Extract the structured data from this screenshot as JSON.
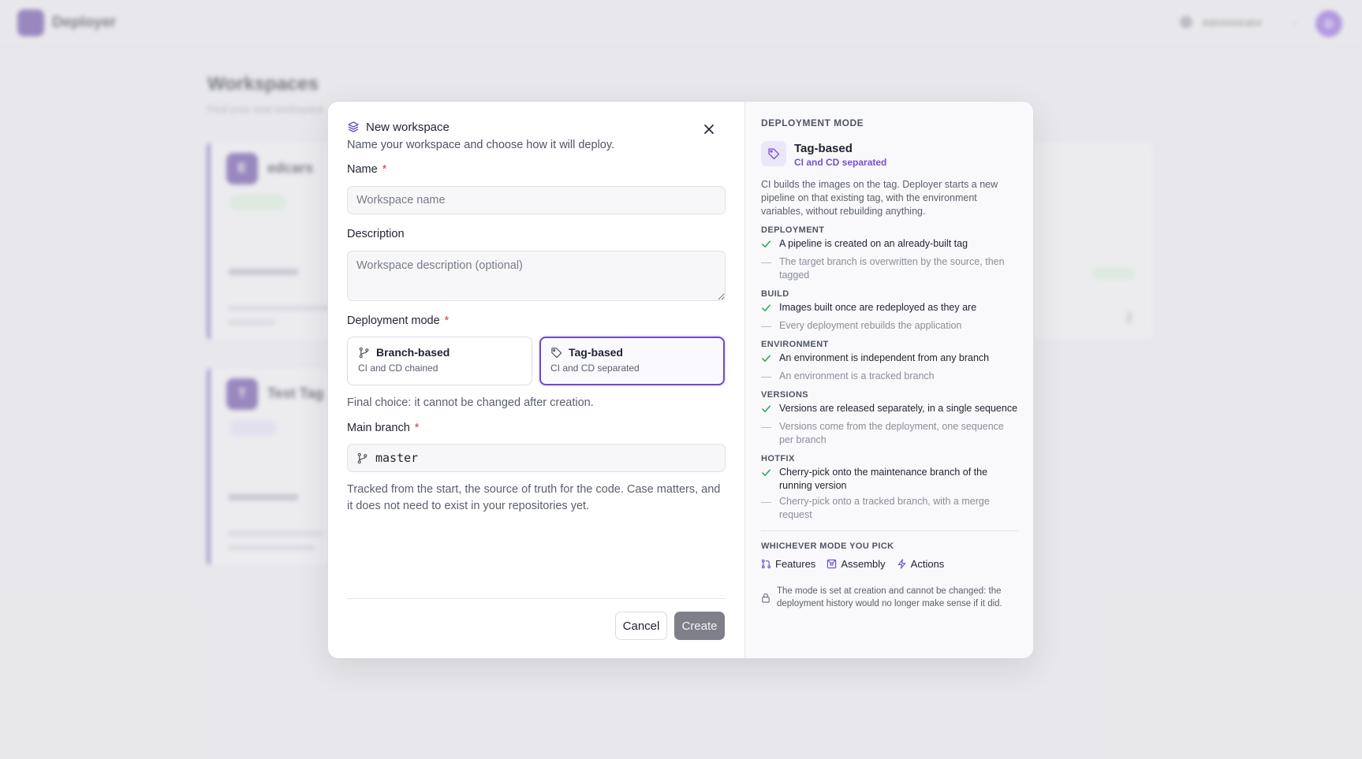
{
  "background": {
    "app_name": "Deployer",
    "user_name": "Administrator",
    "avatar_initial": "D",
    "page_title": "Workspaces",
    "page_subtitle": "Find your new workspace",
    "cards": [
      {
        "initial": "E",
        "name": "edcars",
        "owner": "Administrator"
      },
      {
        "initial": "T",
        "name": "Test Tag",
        "owner": "Administrator"
      }
    ]
  },
  "modal": {
    "title": "New workspace",
    "subtitle": "Name your workspace and choose how it will deploy.",
    "close_icon": "close-icon",
    "name_field": {
      "label": "Name",
      "required": "*",
      "placeholder": "Workspace name",
      "value": ""
    },
    "description_field": {
      "label": "Description",
      "placeholder": "Workspace description (optional)",
      "value": ""
    },
    "deployment_mode": {
      "label": "Deployment mode",
      "required": "*",
      "options": [
        {
          "title": "Branch-based",
          "subtitle": "CI and CD chained",
          "icon": "git-branch-icon",
          "selected": false
        },
        {
          "title": "Tag-based",
          "subtitle": "CI and CD separated",
          "icon": "tag-icon",
          "selected": true
        }
      ],
      "hint": "Final choice: it cannot be changed after creation."
    },
    "main_branch": {
      "label": "Main branch",
      "required": "*",
      "value": "master",
      "hint": "Tracked from the start, the source of truth for the code. Case matters, and it does not need to exist in your repositories yet."
    },
    "actions": {
      "cancel": "Cancel",
      "create": "Create"
    }
  },
  "side_panel": {
    "heading": "DEPLOYMENT MODE",
    "mode_title": "Tag-based",
    "mode_subtitle": "CI and CD separated",
    "description": "CI builds the images on the tag. Deployer starts a new pipeline on that existing tag, with the environment variables, without rebuilding anything.",
    "sections": [
      {
        "title": "DEPLOYMENT",
        "yes": "A pipeline is created on an already-built tag",
        "no": "The target branch is overwritten by the source, then tagged"
      },
      {
        "title": "BUILD",
        "yes": "Images built once are redeployed as they are",
        "no": "Every deployment rebuilds the application"
      },
      {
        "title": "ENVIRONMENT",
        "yes": "An environment is independent from any branch",
        "no": "An environment is a tracked branch"
      },
      {
        "title": "VERSIONS",
        "yes": "Versions are released separately, in a single sequence",
        "no": "Versions come from the deployment, one sequence per branch"
      },
      {
        "title": "HOTFIX",
        "yes": "Cherry-pick onto the maintenance branch of the running version",
        "no": "Cherry-pick onto a tracked branch, with a merge request"
      }
    ],
    "common_heading": "WHICHEVER MODE YOU PICK",
    "common_items": [
      {
        "label": "Features",
        "icon": "pull-request-icon"
      },
      {
        "label": "Assembly",
        "icon": "assembly-icon"
      },
      {
        "label": "Actions",
        "icon": "lightning-icon"
      }
    ],
    "note": "The mode is set at creation and cannot be changed: the deployment history would no longer make sense if it did.",
    "colors": {
      "accent": "#6d4cc4",
      "check": "#2e9e57",
      "required": "#d93b3b"
    }
  }
}
